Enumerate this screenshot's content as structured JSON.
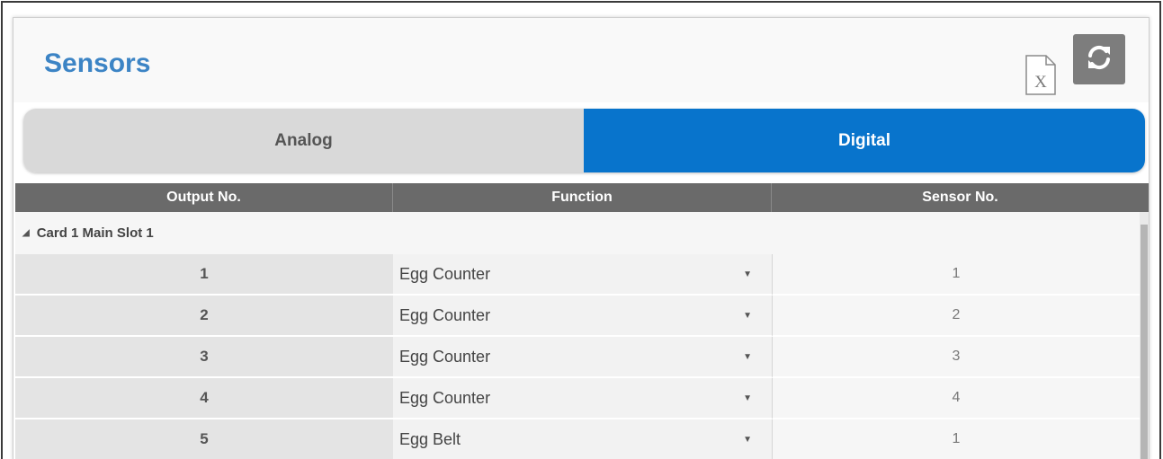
{
  "header": {
    "title": "Sensors",
    "excel_icon": "excel-export-icon",
    "refresh_icon": "refresh-icon"
  },
  "tabs": [
    {
      "label": "Analog",
      "active": false
    },
    {
      "label": "Digital",
      "active": true
    }
  ],
  "colors": {
    "title": "#3c84c5",
    "active_tab": "#0874cc",
    "inactive_tab": "#d9d9d9",
    "table_header": "#6a6a6a",
    "refresh_button": "#7d7d7d"
  },
  "table": {
    "columns": [
      "Output No.",
      "Function",
      "Sensor No."
    ],
    "group": {
      "label": "Card 1 Main Slot 1",
      "expanded": true
    },
    "rows": [
      {
        "output": "1",
        "function": "Egg Counter",
        "sensor": "1"
      },
      {
        "output": "2",
        "function": "Egg Counter",
        "sensor": "2"
      },
      {
        "output": "3",
        "function": "Egg Counter",
        "sensor": "3"
      },
      {
        "output": "4",
        "function": "Egg Counter",
        "sensor": "4"
      },
      {
        "output": "5",
        "function": "Egg Belt",
        "sensor": "1"
      }
    ]
  }
}
